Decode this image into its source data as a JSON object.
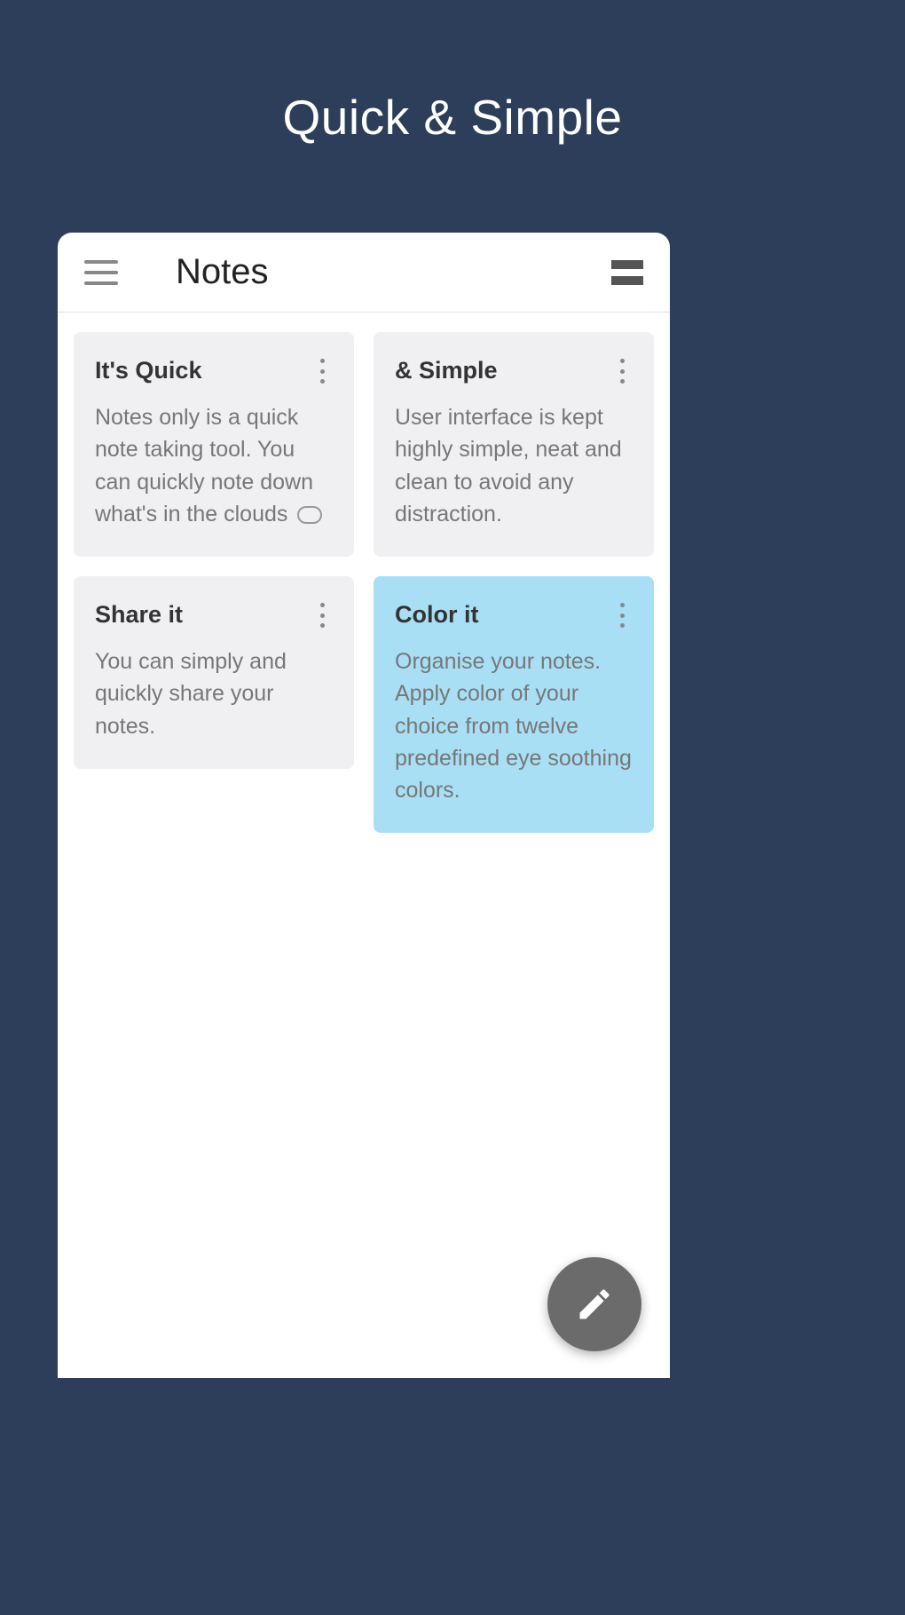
{
  "promo": {
    "title": "Quick & Simple"
  },
  "header": {
    "title": "Notes"
  },
  "notes": {
    "left": [
      {
        "title": "It's Quick",
        "body": "Notes only is a quick note taking tool. You can quickly note down what's in the clouds"
      },
      {
        "title": "Share it",
        "body": "You can simply and quickly share your notes."
      }
    ],
    "right": [
      {
        "title": "& Simple",
        "body": "User interface is kept highly simple, neat and clean to avoid any distraction."
      },
      {
        "title": "Color it",
        "body": "Organise your notes. Apply color of your choice from twelve predefined eye soothing colors."
      }
    ]
  }
}
